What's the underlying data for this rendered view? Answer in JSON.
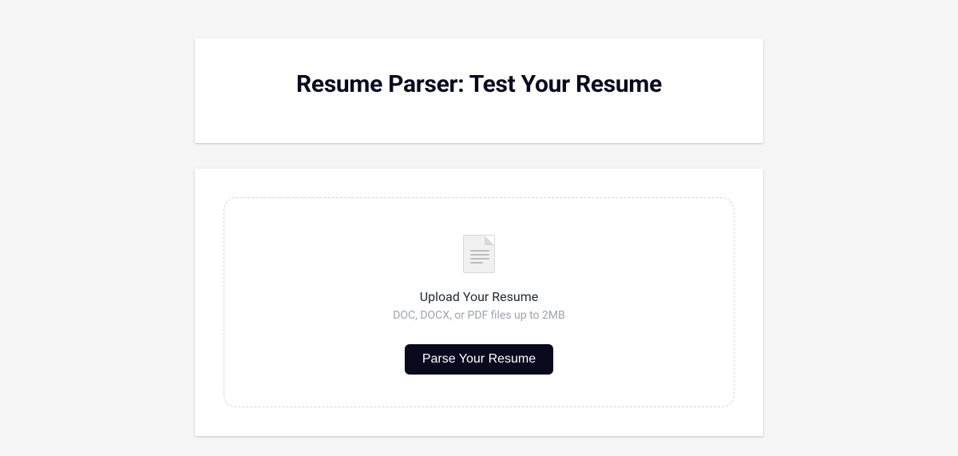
{
  "header": {
    "title": "Resume Parser: Test Your Resume"
  },
  "upload": {
    "title": "Upload Your Resume",
    "subtitle": "DOC, DOCX, or PDF files up to 2MB",
    "button_label": "Parse Your Resume"
  }
}
